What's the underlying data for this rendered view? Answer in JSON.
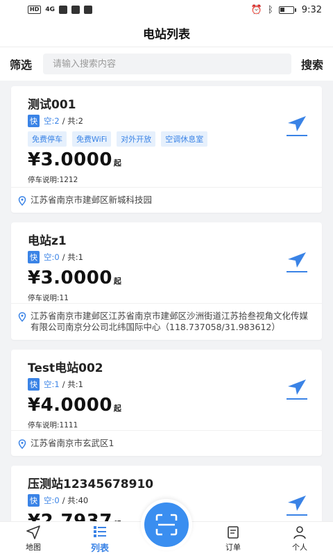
{
  "status_bar": {
    "left_labels": [
      "HD",
      "4G"
    ],
    "time": "9:32"
  },
  "header": {
    "title": "电站列表"
  },
  "search": {
    "filter_label": "筛选",
    "placeholder": "请输入搜索内容",
    "search_label": "搜索"
  },
  "stations": [
    {
      "name": "测试001",
      "fast_label": "快",
      "free_text": "空:2",
      "total_text": "/ 共:2",
      "tags": [
        "免费停车",
        "免费WiFi",
        "对外开放",
        "空调休息室"
      ],
      "price": "¥3.0000",
      "price_suffix": "起",
      "note": "停车说明:1212",
      "address": "江苏省南京市建邺区新城科技园"
    },
    {
      "name": "电站z1",
      "fast_label": "快",
      "free_text": "空:0",
      "total_text": "/ 共:1",
      "tags": [],
      "price": "¥3.0000",
      "price_suffix": "起",
      "note": "停车说明:11",
      "address": "江苏省南京市建邺区江苏省南京市建邺区沙洲街道江苏拾叁视角文化传媒有限公司南京分公司北纬国际中心（118.737058/31.983612）"
    },
    {
      "name": "Test电站002",
      "fast_label": "快",
      "free_text": "空:1",
      "total_text": "/ 共:1",
      "tags": [],
      "price": "¥4.0000",
      "price_suffix": "起",
      "note": "停车说明:1111",
      "address": "江苏省南京市玄武区1"
    },
    {
      "name": "压测站12345678910",
      "fast_label": "快",
      "free_text": "空:0",
      "total_text": "/ 共:40",
      "tags": [],
      "price": "¥2.7937",
      "price_suffix": "起",
      "note": "",
      "address": ""
    }
  ],
  "tabbar": {
    "items": [
      {
        "label": "地图",
        "icon": "map-navigation-icon"
      },
      {
        "label": "列表",
        "icon": "list-icon"
      },
      {
        "label": "订单",
        "icon": "order-icon"
      },
      {
        "label": "个人",
        "icon": "person-icon"
      }
    ],
    "active": "列表",
    "scan_icon": "scan-icon"
  },
  "colors": {
    "accent": "#3a83e6",
    "tag_bg": "#e6f0fc",
    "page_bg": "#f2f3f5"
  }
}
